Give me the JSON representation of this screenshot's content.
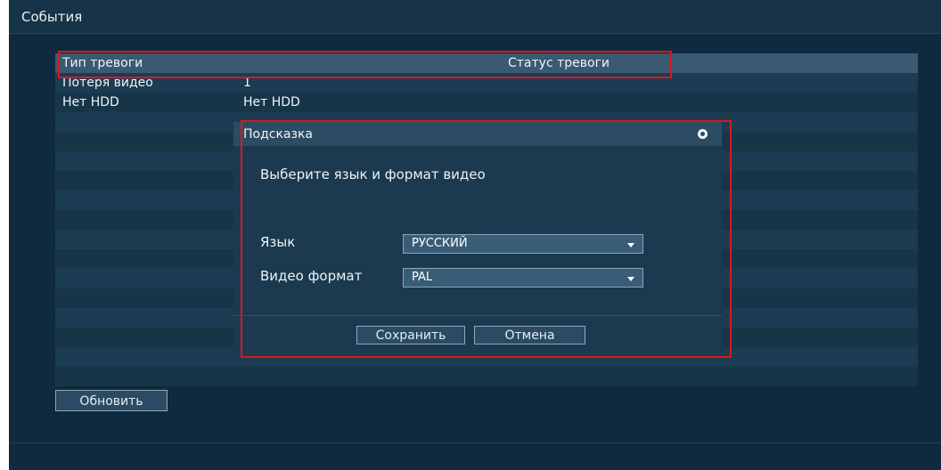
{
  "page": {
    "title": "События"
  },
  "table": {
    "columns": [
      "Тип тревоги",
      "Статус тревоги"
    ],
    "rows": [
      {
        "type": "Потеря видео",
        "status": "1"
      },
      {
        "type": "Нет HDD",
        "status": "Нет HDD"
      }
    ]
  },
  "dialog": {
    "title": "Подсказка",
    "message": "Выберите язык и формат видео",
    "language_label": "Язык",
    "language_value": "РУССКИЙ",
    "video_format_label": "Видео формат",
    "video_format_value": "PAL",
    "save_label": "Сохранить",
    "cancel_label": "Отмена"
  },
  "refresh_label": "Обновить",
  "colors": {
    "background": "#0f2a3e",
    "highlight": "#e0151f",
    "header_row": "#3a5a72"
  },
  "icons": {
    "dialog_close": "power-icon",
    "dropdown": "chevron-down-icon"
  }
}
